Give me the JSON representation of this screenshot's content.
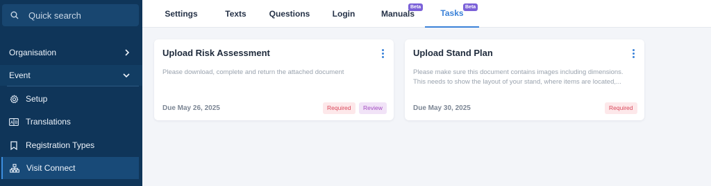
{
  "search": {
    "placeholder": "Quick search"
  },
  "sidebar": {
    "organisation": "Organisation",
    "event": "Event",
    "items": [
      {
        "label": "Setup",
        "icon": "gear-icon"
      },
      {
        "label": "Translations",
        "icon": "translate-icon"
      },
      {
        "label": "Registration Types",
        "icon": "bookmark-icon"
      },
      {
        "label": "Visit Connect",
        "icon": "network-icon"
      }
    ]
  },
  "tabs": [
    {
      "label": "Settings"
    },
    {
      "label": "Texts"
    },
    {
      "label": "Questions"
    },
    {
      "label": "Login"
    },
    {
      "label": "Manuals",
      "badge": "Beta"
    },
    {
      "label": "Tasks",
      "badge": "Beta",
      "active": true
    }
  ],
  "cards": [
    {
      "title": "Upload Risk Assessment",
      "description": "Please download, complete and return the attached document",
      "due": "Due May 26, 2025",
      "badges": [
        "Required",
        "Review"
      ]
    },
    {
      "title": "Upload Stand Plan",
      "description": "Please make sure this document contains images including dimensions. This needs to show the layout of your stand, where items are located,...",
      "due": "Due May 30, 2025",
      "badges": [
        "Required"
      ]
    }
  ],
  "colors": {
    "sidebar": "#0f3559",
    "accent": "#3b82d8",
    "beta": "#7b61d8"
  }
}
